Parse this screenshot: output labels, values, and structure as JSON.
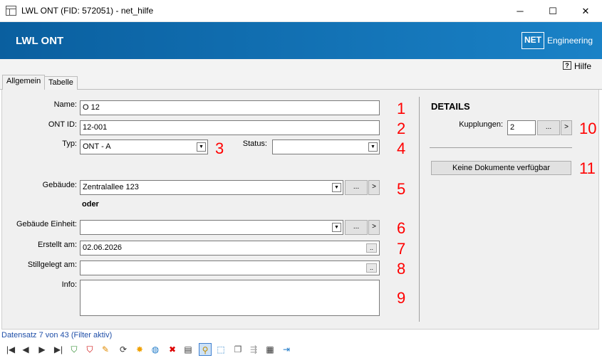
{
  "window": {
    "title": "LWL ONT (FID: 572051) - net_hilfe",
    "minimize_glyph": "─",
    "maximize_glyph": "☐",
    "close_glyph": "✕"
  },
  "banner": {
    "title": "LWL ONT",
    "logo_box": "NET",
    "logo_text": "Engineering",
    "gradient_start": "#0a5f9f",
    "gradient_end": "#1a82c7"
  },
  "help": {
    "icon_glyph": "?",
    "label": "Hilfe"
  },
  "tabs": [
    {
      "label": "Allgemein",
      "active": true
    },
    {
      "label": "Tabelle",
      "active": false
    }
  ],
  "form": {
    "name": {
      "label": "Name:",
      "value": "O 12",
      "marker": "1"
    },
    "ont_id": {
      "label": "ONT ID:",
      "value": "12-001",
      "marker": "2"
    },
    "typ": {
      "label": "Typ:",
      "value": "ONT - A",
      "marker": "3"
    },
    "status": {
      "label": "Status:",
      "value": "",
      "marker": "4"
    },
    "gebaeude": {
      "label": "Gebäude:",
      "value": "Zentralallee 123",
      "marker": "5"
    },
    "oder": "oder",
    "gebaeude_einheit": {
      "label": "Gebäude Einheit:",
      "value": "",
      "marker": "6"
    },
    "erstellt_am": {
      "label": "Erstellt am:",
      "value": "02.06.2026",
      "marker": "7"
    },
    "stillgelegt_am": {
      "label": "Stillgelegt am:",
      "value": "",
      "marker": "8"
    },
    "info": {
      "label": "Info:",
      "value": "",
      "marker": "9"
    }
  },
  "details": {
    "title": "DETAILS",
    "kupplungen": {
      "label": "Kupplungen:",
      "value": "2",
      "marker": "10"
    },
    "documents_button": {
      "label": "Keine Dokumente verfügbar",
      "marker": "11"
    }
  },
  "glyphs": {
    "ellipsis": "...",
    "small_ellipsis": "..",
    "next": ">",
    "dropdown": "▼"
  },
  "status_bar": {
    "text": "Datensatz 7 von 43 (Filter aktiv)"
  },
  "toolbar": [
    {
      "name": "first-record-icon",
      "glyph": "|◀",
      "color": "#333333"
    },
    {
      "name": "previous-record-icon",
      "glyph": "◀",
      "color": "#333333"
    },
    {
      "name": "next-record-icon",
      "glyph": "▶",
      "color": "#333333"
    },
    {
      "name": "last-record-icon",
      "glyph": "▶|",
      "color": "#333333"
    },
    {
      "name": "add-filter-icon",
      "glyph": "⛉",
      "color": "#2a8a2a"
    },
    {
      "name": "remove-filter-icon",
      "glyph": "⛉",
      "color": "#cc0000"
    },
    {
      "name": "edit-pencil-icon",
      "glyph": "✎",
      "color": "#e08a00"
    },
    {
      "name": "refresh-icon",
      "glyph": "⟳",
      "color": "#333333"
    },
    {
      "name": "new-record-icon",
      "glyph": "✸",
      "color": "#f0a000"
    },
    {
      "name": "globe-icon",
      "glyph": "◍",
      "color": "#1f7ac8"
    },
    {
      "name": "delete-icon",
      "glyph": "✖",
      "color": "#dd0000"
    },
    {
      "name": "print-icon",
      "glyph": "▤",
      "color": "#333333"
    },
    {
      "name": "zoom-icon",
      "glyph": "⚲",
      "color": "#c08a00"
    },
    {
      "name": "select-area-icon",
      "glyph": "⬚",
      "color": "#1f7ac8"
    },
    {
      "name": "copy-icon",
      "glyph": "❐",
      "color": "#555555"
    },
    {
      "name": "merge-icon",
      "glyph": "⇶",
      "color": "#999999"
    },
    {
      "name": "table-edit-icon",
      "glyph": "▦",
      "color": "#333333"
    },
    {
      "name": "exit-icon",
      "glyph": "⇥",
      "color": "#1f7ac8"
    }
  ]
}
